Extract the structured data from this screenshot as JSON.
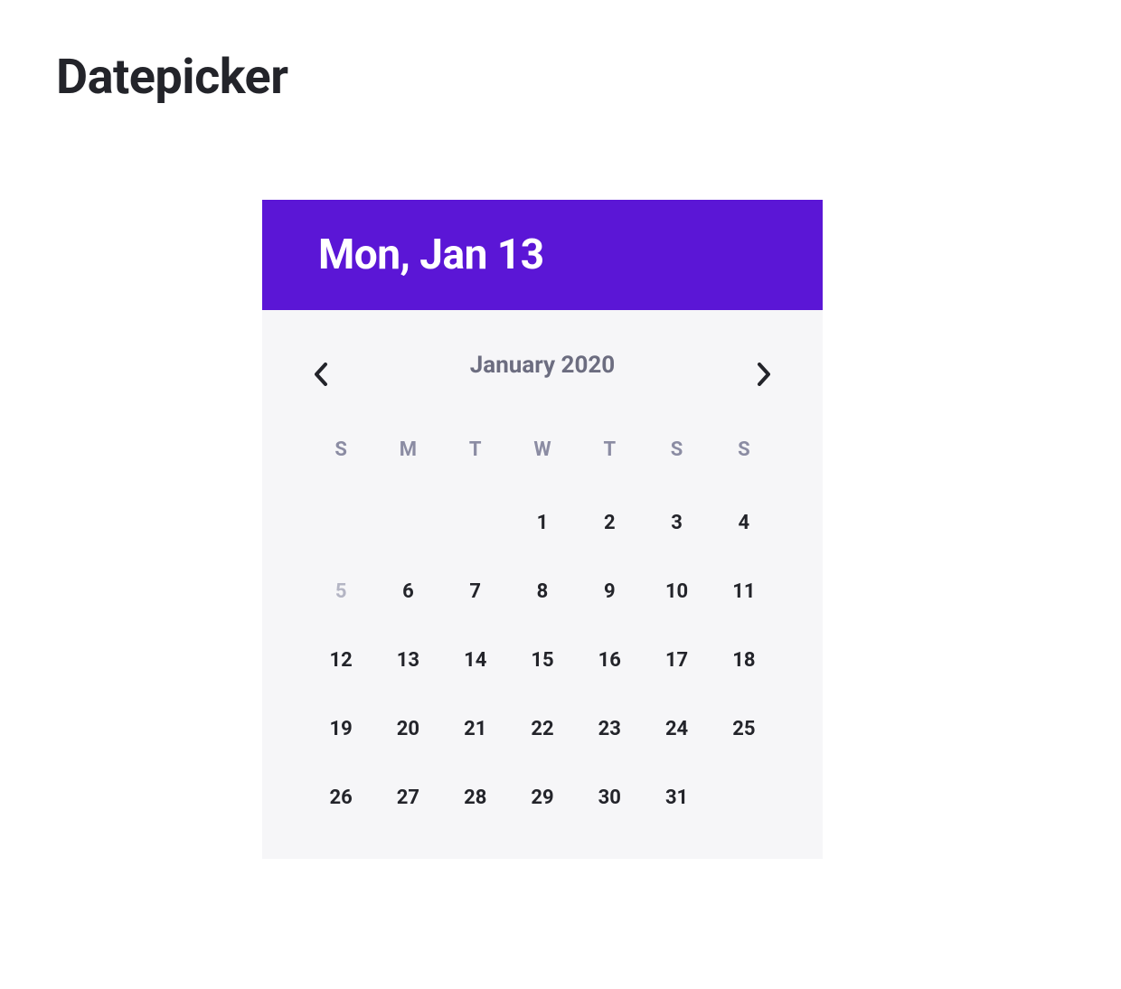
{
  "page": {
    "title": "Datepicker"
  },
  "datepicker": {
    "selected_label": "Mon, Jan 13",
    "month_label": "January 2020",
    "dow": [
      "S",
      "M",
      "T",
      "W",
      "T",
      "S",
      "S"
    ],
    "weeks": [
      [
        {
          "n": "",
          "state": "empty"
        },
        {
          "n": "",
          "state": "empty"
        },
        {
          "n": "",
          "state": "empty"
        },
        {
          "n": "1",
          "state": ""
        },
        {
          "n": "2",
          "state": ""
        },
        {
          "n": "3",
          "state": ""
        },
        {
          "n": "4",
          "state": ""
        }
      ],
      [
        {
          "n": "5",
          "state": "disabled"
        },
        {
          "n": "6",
          "state": ""
        },
        {
          "n": "7",
          "state": ""
        },
        {
          "n": "8",
          "state": ""
        },
        {
          "n": "9",
          "state": ""
        },
        {
          "n": "10",
          "state": ""
        },
        {
          "n": "11",
          "state": ""
        }
      ],
      [
        {
          "n": "12",
          "state": ""
        },
        {
          "n": "13",
          "state": ""
        },
        {
          "n": "14",
          "state": ""
        },
        {
          "n": "15",
          "state": ""
        },
        {
          "n": "16",
          "state": ""
        },
        {
          "n": "17",
          "state": ""
        },
        {
          "n": "18",
          "state": ""
        }
      ],
      [
        {
          "n": "19",
          "state": ""
        },
        {
          "n": "20",
          "state": ""
        },
        {
          "n": "21",
          "state": ""
        },
        {
          "n": "22",
          "state": ""
        },
        {
          "n": "23",
          "state": ""
        },
        {
          "n": "24",
          "state": ""
        },
        {
          "n": "25",
          "state": ""
        }
      ],
      [
        {
          "n": "26",
          "state": ""
        },
        {
          "n": "27",
          "state": ""
        },
        {
          "n": "28",
          "state": ""
        },
        {
          "n": "29",
          "state": ""
        },
        {
          "n": "30",
          "state": ""
        },
        {
          "n": "31",
          "state": ""
        },
        {
          "n": "",
          "state": "empty"
        }
      ]
    ]
  },
  "colors": {
    "accent": "#5b16d6",
    "text": "#23242a",
    "muted": "#8b8ca3"
  }
}
